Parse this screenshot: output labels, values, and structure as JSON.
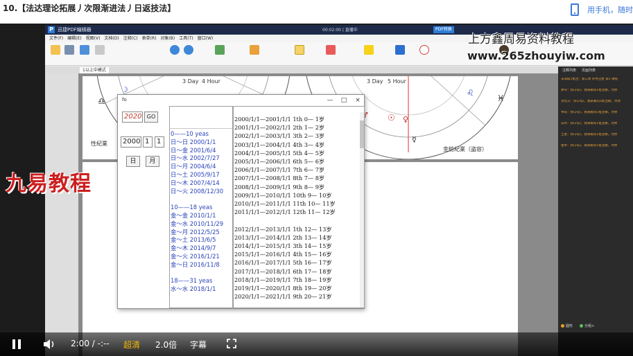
{
  "course": {
    "title": "10.【法达理论拓展丿次限渐进法丿日返技法】"
  },
  "phone": {
    "text": "用手机，随时"
  },
  "app": {
    "title": "迅捷PDF编辑器",
    "timer": "00:02:00 | 直播中",
    "pdf_chip": "PDF转换",
    "menu": [
      "文件(F)",
      "编辑(E)",
      "视图(V)",
      "文档(D)",
      "注释(C)",
      "表单(R)",
      "对象(B)",
      "工具(T)",
      "窗口(W)"
    ],
    "tabs": [
      "1以上中模式"
    ],
    "panel_tabs": [
      "注释列表",
      "页面列表"
    ],
    "panel_lines": [
      "未读取1批注：第三周 外界占星 第5 课程",
      "律令：弥(2号)，我来看同1批注哪，为你",
      "对比方：弥(2号)，我来看同1批注哪，为你",
      "书号：弥(2号)，我来看同1批注哪，为你",
      "日月：弥(2号)，我来看同1批注哪，为你",
      "土星：弥(2号)，我来看同1批注哪，为你",
      "金木：弥(2号)，我来看同1批注哪，为你"
    ],
    "panel_foot": [
      "圆形",
      "分组+"
    ]
  },
  "chart_page": {
    "labels": [
      "3 Day",
      "4 Hour",
      "3 Day",
      "5 Hour",
      "性紀業",
      "金紡紀業（盗容）"
    ]
  },
  "dialog": {
    "title": "fo",
    "controls": [
      "—",
      "□",
      "×"
    ],
    "year_value": "2020",
    "go_label": "GO",
    "spin_year": "2000",
    "spin_month": "1",
    "spin_day": "1",
    "btn_day": "日",
    "btn_month": "月",
    "mid_list": [
      "0——10 yeas",
      "日～日 2000/1/1",
      "日～金 2001/6/4",
      "日～水 2002/7/27",
      "日～月 2004/6/4",
      "日～土 2005/9/17",
      "日～木 2007/4/14",
      "日～火 2008/12/30",
      "",
      "10——18 yeas",
      "金～金 2010/1/1",
      "金～水 2010/11/29",
      "金～月 2012/5/25",
      "金～土 2013/6/5",
      "金～木 2014/9/7",
      "金～火 2016/1/21",
      "金～日 2016/11/8",
      "",
      "18——31 yeas",
      "水～水 2018/1/1"
    ],
    "right_list": [
      "2000/1/1—2001/1/1   1th   0— 1岁",
      "2001/1/1—2002/1/1   2th   1— 2岁",
      "2002/1/1—2003/1/1   3th   2— 3岁",
      "2003/1/1—2004/1/1   4th   3— 4岁",
      "2004/1/1—2005/1/1   5th   4— 5岁",
      "2005/1/1—2006/1/1   6th   5— 6岁",
      "2006/1/1—2007/1/1   7th   6— 7岁",
      "2007/1/1—2008/1/1   8th   7— 8岁",
      "2008/1/1—2009/1/1   9th   8— 9岁",
      "2009/1/1—2010/1/1   10th   9— 10岁",
      "2010/1/1—2011/1/1   11th   10— 11岁",
      "2011/1/1—2012/1/1   12th   11— 12岁",
      "",
      "2012/1/1—2013/1/1   1th   12— 13岁",
      "2013/1/1—2014/1/1   2th   13— 14岁",
      "2014/1/1—2015/1/1   3th   14— 15岁",
      "2015/1/1—2016/1/1   4th   15— 16岁",
      "2016/1/1—2017/1/1   5th   16— 17岁",
      "2017/1/1—2018/1/1   6th   17— 18岁",
      "2018/1/1—2019/1/1   7th   18— 19岁",
      "2019/1/1—2020/1/1   8th   19— 20岁",
      "2020/1/1—2021/1/1   9th   20— 21岁"
    ]
  },
  "watermarks": {
    "brand": "九易教程",
    "site_name": "上方鑫周易资料教程",
    "site_url": "www.265zhouyiw.com"
  },
  "player": {
    "time": "2:00 / -:--",
    "quality": "超清",
    "speed": "2.0倍",
    "subtitle": "字幕",
    "quality_color": "#f0b400"
  }
}
